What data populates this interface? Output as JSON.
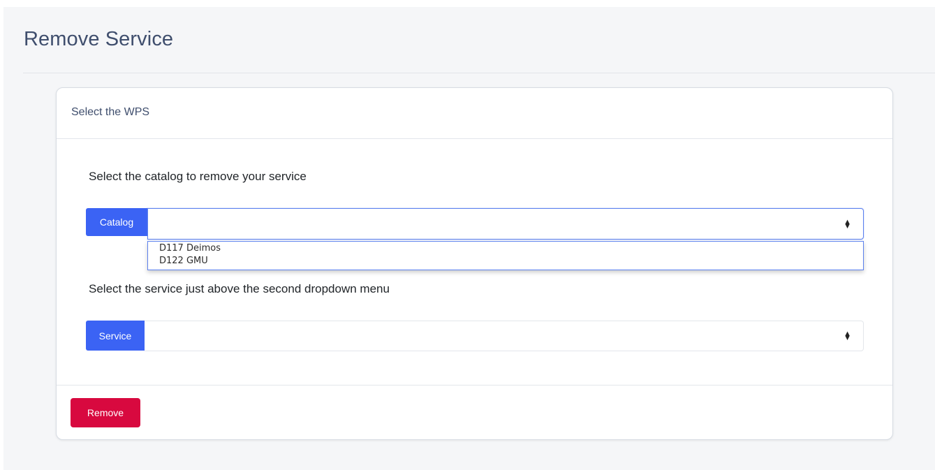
{
  "page": {
    "title": "Remove Service"
  },
  "card": {
    "header": "Select the WPS",
    "catalog_section": {
      "label": "Select the catalog to remove your service",
      "addon": "Catalog",
      "selected_value": "",
      "options": [
        "D117 Deimos",
        "D122 GMU"
      ]
    },
    "service_section": {
      "label": "Select the service just above the second dropdown menu",
      "addon": "Service",
      "selected_value": ""
    },
    "remove_button": "Remove"
  },
  "colors": {
    "accent": "#3b63f4",
    "danger": "#d8093f",
    "title": "#3f4e6d"
  }
}
